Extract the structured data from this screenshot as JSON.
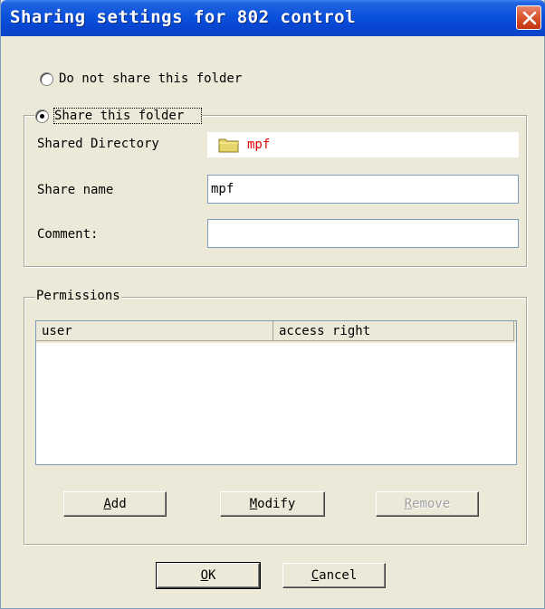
{
  "window": {
    "title": "Sharing settings for 802 control"
  },
  "sharing": {
    "option_no_share": "Do not share this folder",
    "option_share": "Share this folder",
    "selected": "share"
  },
  "fields": {
    "shared_directory_label": "Shared Directory",
    "shared_directory_value": "mpf",
    "share_name_label": "Share name",
    "share_name_value": "mpf",
    "comment_label": "Comment:",
    "comment_value": ""
  },
  "permissions": {
    "group_label": "Permissions",
    "columns": [
      "user",
      "access right"
    ],
    "rows": []
  },
  "buttons": {
    "add_mnemonic": "A",
    "add_rest": "dd",
    "modify_mnemonic": "M",
    "modify_rest": "odify",
    "remove_mnemonic": "R",
    "remove_rest": "emove",
    "ok_mnemonic": "O",
    "ok_rest": "K",
    "cancel_mnemonic": "C",
    "cancel_rest": "ancel"
  },
  "colors": {
    "title_bar": "#0a52dc",
    "dialog_bg": "#ece9d8",
    "folder_text": "#e00000",
    "close_button": "#d9542d"
  },
  "icons": {
    "close": "close-icon",
    "folder": "folder-icon"
  }
}
